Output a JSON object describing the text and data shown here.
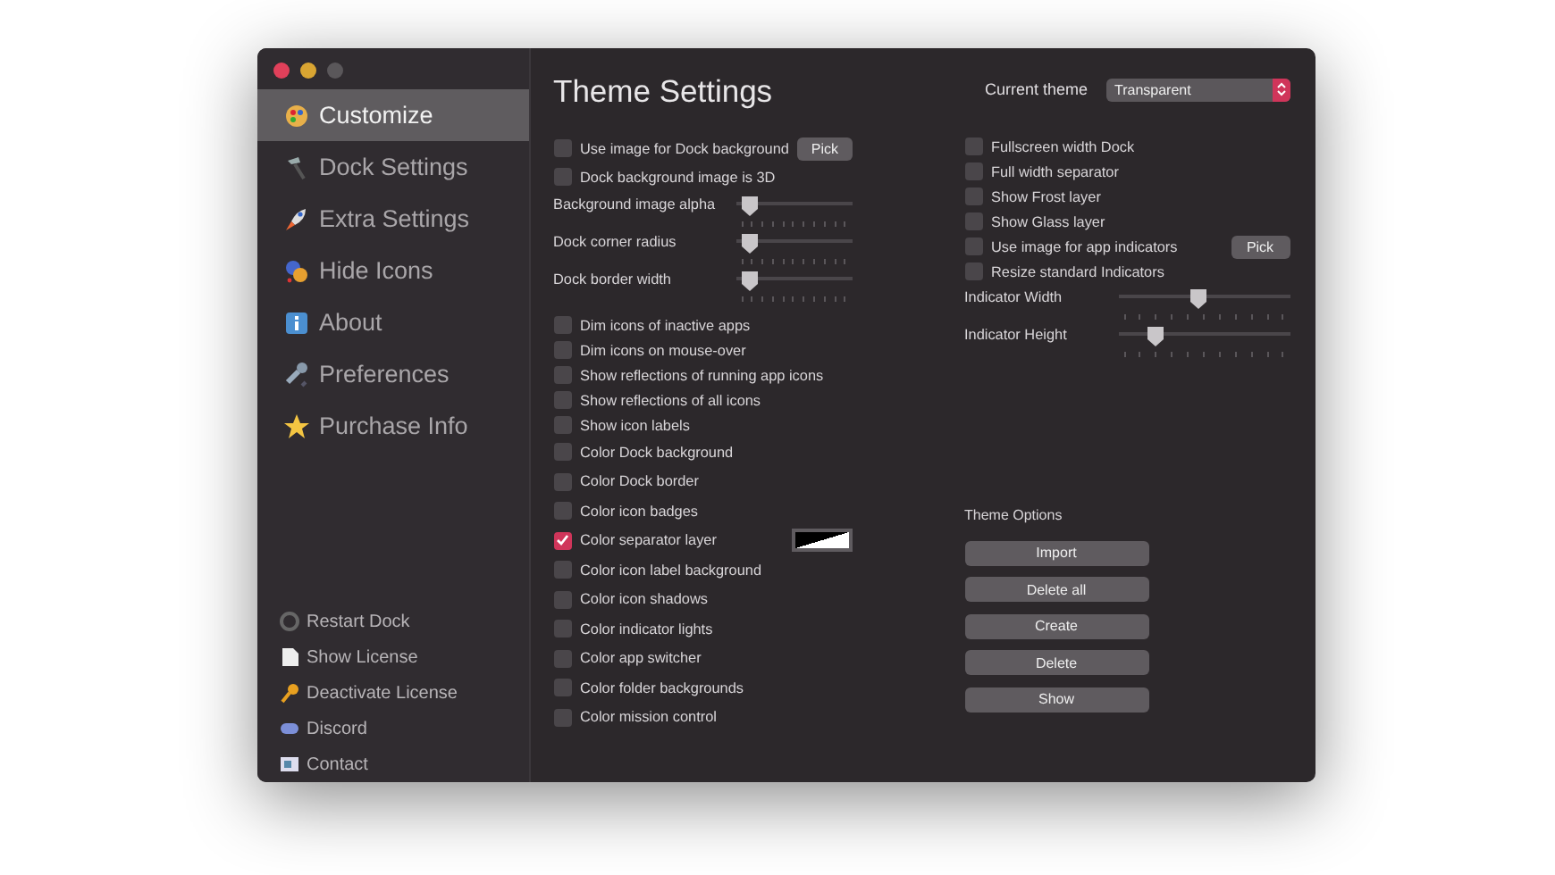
{
  "window": {
    "traffic_lights": [
      {
        "color": "#e0405a"
      },
      {
        "color": "#d9a532"
      },
      {
        "color": "#5a575a"
      }
    ]
  },
  "sidebar": {
    "items": [
      {
        "label": "Customize",
        "selected": true
      },
      {
        "label": "Dock Settings",
        "selected": false
      },
      {
        "label": "Extra Settings",
        "selected": false
      },
      {
        "label": "Hide Icons",
        "selected": false
      },
      {
        "label": "About",
        "selected": false
      },
      {
        "label": "Preferences",
        "selected": false
      },
      {
        "label": "Purchase Info",
        "selected": false
      }
    ],
    "actions": [
      "Restart Dock",
      "Show License",
      "Deactivate License",
      "Discord",
      "Contact"
    ]
  },
  "title": "Theme Settings",
  "current_theme": {
    "label": "Current theme",
    "value": "Transparent"
  },
  "left_groups": [
    {
      "rows": [
        {
          "kind": "checkbox",
          "label": "Use image for Dock background",
          "checked": false,
          "button": "Pick"
        },
        {
          "kind": "checkbox",
          "label": "Dock background image is 3D",
          "checked": false
        },
        {
          "kind": "slider",
          "label": "Background image alpha",
          "level": 0.05
        },
        {
          "kind": "slider",
          "label": "Dock corner radius",
          "level": 0.05
        },
        {
          "kind": "slider",
          "label": "Dock border width",
          "level": 0.05
        }
      ]
    },
    {
      "rows": [
        {
          "kind": "checkbox",
          "label": "Dim icons of inactive apps",
          "checked": false
        },
        {
          "kind": "checkbox",
          "label": "Dim icons on mouse-over",
          "checked": false
        },
        {
          "kind": "checkbox",
          "label": "Show reflections of running app icons",
          "checked": false
        },
        {
          "kind": "checkbox",
          "label": "Show reflections of all icons",
          "checked": false
        },
        {
          "kind": "checkbox",
          "label": "Show icon labels",
          "checked": false
        }
      ]
    },
    {
      "rows": [
        {
          "kind": "checkbox",
          "label": "Color Dock background",
          "checked": false
        },
        {
          "kind": "checkbox",
          "label": "Color Dock border",
          "checked": false
        },
        {
          "kind": "checkbox",
          "label": "Color icon badges",
          "checked": false
        },
        {
          "kind": "checkbox",
          "label": "Color separator layer",
          "checked": true,
          "swatch": true
        },
        {
          "kind": "checkbox",
          "label": "Color icon label background",
          "checked": false
        },
        {
          "kind": "checkbox",
          "label": "Color icon shadows",
          "checked": false
        },
        {
          "kind": "checkbox",
          "label": "Color indicator lights",
          "checked": false
        },
        {
          "kind": "checkbox",
          "label": "Color app switcher",
          "checked": false
        },
        {
          "kind": "checkbox",
          "label": "Color folder backgrounds",
          "checked": false
        },
        {
          "kind": "checkbox",
          "label": "Color mission control",
          "checked": false
        }
      ]
    }
  ],
  "right_rows": [
    {
      "kind": "checkbox",
      "label": "Fullscreen width Dock",
      "checked": false
    },
    {
      "kind": "checkbox",
      "label": "Full width separator",
      "checked": false
    },
    {
      "kind": "checkbox",
      "label": "Show Frost layer",
      "checked": false
    },
    {
      "kind": "checkbox",
      "label": "Show Glass layer",
      "checked": false
    },
    {
      "kind": "checkbox",
      "label": "Use image for app indicators",
      "checked": false,
      "button": "Pick"
    },
    {
      "kind": "checkbox",
      "label": "Resize standard Indicators",
      "checked": false
    },
    {
      "kind": "slider",
      "label": "Indicator Width",
      "level": 0.47
    },
    {
      "kind": "slider",
      "label": "Indicator Height",
      "level": 0.18
    }
  ],
  "theme_options": {
    "title": "Theme Options",
    "buttons": [
      "Import",
      "Delete all",
      "Create",
      "Delete",
      "Show"
    ]
  }
}
